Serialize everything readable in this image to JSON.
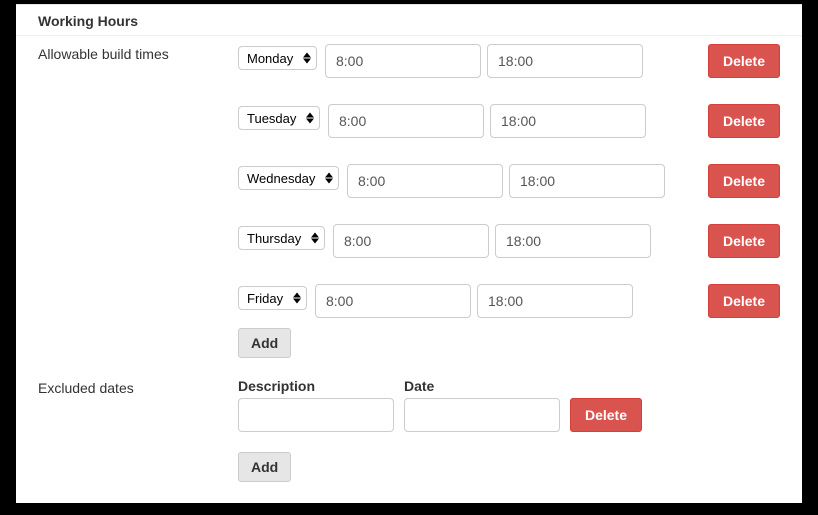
{
  "section_title": "Working Hours",
  "labels": {
    "allowable": "Allowable build times",
    "excluded": "Excluded dates",
    "add": "Add",
    "delete": "Delete",
    "description": "Description",
    "date": "Date"
  },
  "build_times": [
    {
      "day": "Monday",
      "start": "8:00",
      "end": "18:00"
    },
    {
      "day": "Tuesday",
      "start": "8:00",
      "end": "18:00"
    },
    {
      "day": "Wednesday",
      "start": "8:00",
      "end": "18:00"
    },
    {
      "day": "Thursday",
      "start": "8:00",
      "end": "18:00"
    },
    {
      "day": "Friday",
      "start": "8:00",
      "end": "18:00"
    }
  ],
  "excluded_dates": [
    {
      "description": "",
      "date": ""
    }
  ]
}
